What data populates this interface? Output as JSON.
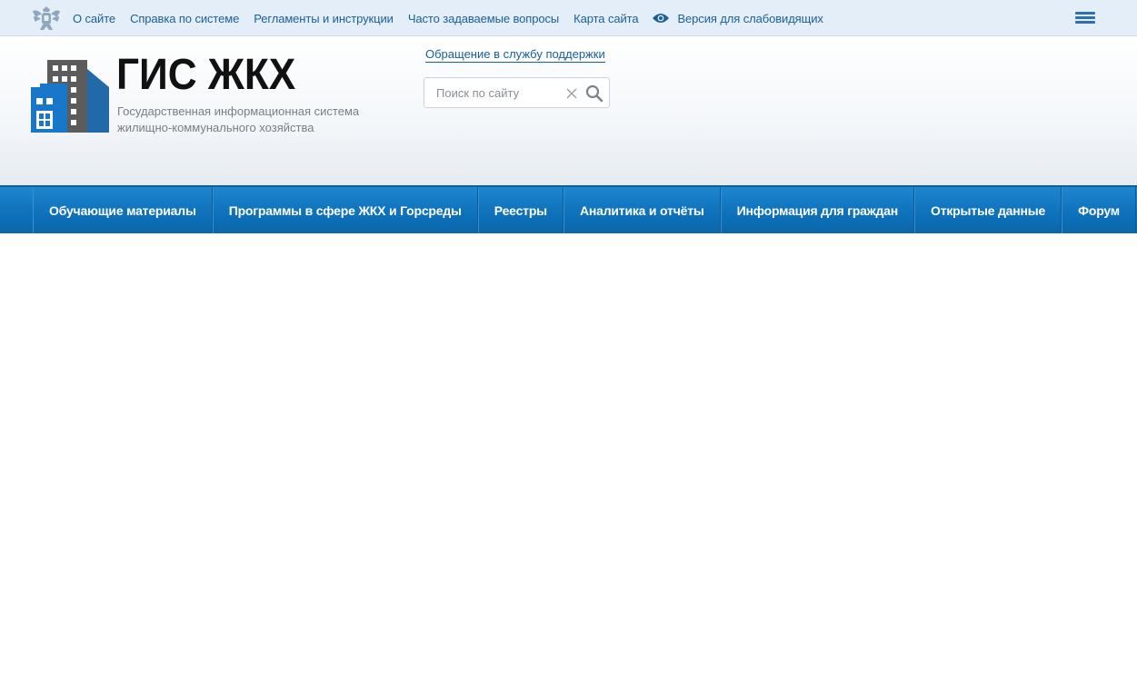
{
  "topbar": {
    "emblem_icon": "coat-of-arms-icon",
    "links": [
      {
        "label": "О сайте"
      },
      {
        "label": "Справка по системе"
      },
      {
        "label": "Регламенты и инструкции"
      },
      {
        "label": "Часто задаваемые вопросы"
      },
      {
        "label": "Карта сайта"
      }
    ],
    "accessibility": {
      "icon": "eye-icon",
      "label": "Версия для слабовидящих"
    },
    "menu_icon": "hamburger-menu-icon"
  },
  "header": {
    "logo_icon": "buildings-logo-icon",
    "title": "ГИС ЖКХ",
    "subtitle_line1": "Государственная информационная система",
    "subtitle_line2": "жилищно-коммунального хозяйства",
    "support_link": "Обращение в службу поддержки",
    "search": {
      "placeholder": "Поиск по сайту",
      "value": ""
    }
  },
  "nav": {
    "items": [
      {
        "label": "Обучающие материалы"
      },
      {
        "label": "Программы в сфере ЖКХ и Горсреды"
      },
      {
        "label": "Реестры"
      },
      {
        "label": "Аналитика и отчёты"
      },
      {
        "label": "Информация для граждан"
      },
      {
        "label": "Открытые данные"
      },
      {
        "label": "Форум"
      }
    ]
  },
  "colors": {
    "topbar_bg": "#e3eef9",
    "link": "#1a5f96",
    "nav_bg": "#0f72bb",
    "logo_blue": "#1877c9",
    "logo_gray": "#5a5a5a"
  }
}
